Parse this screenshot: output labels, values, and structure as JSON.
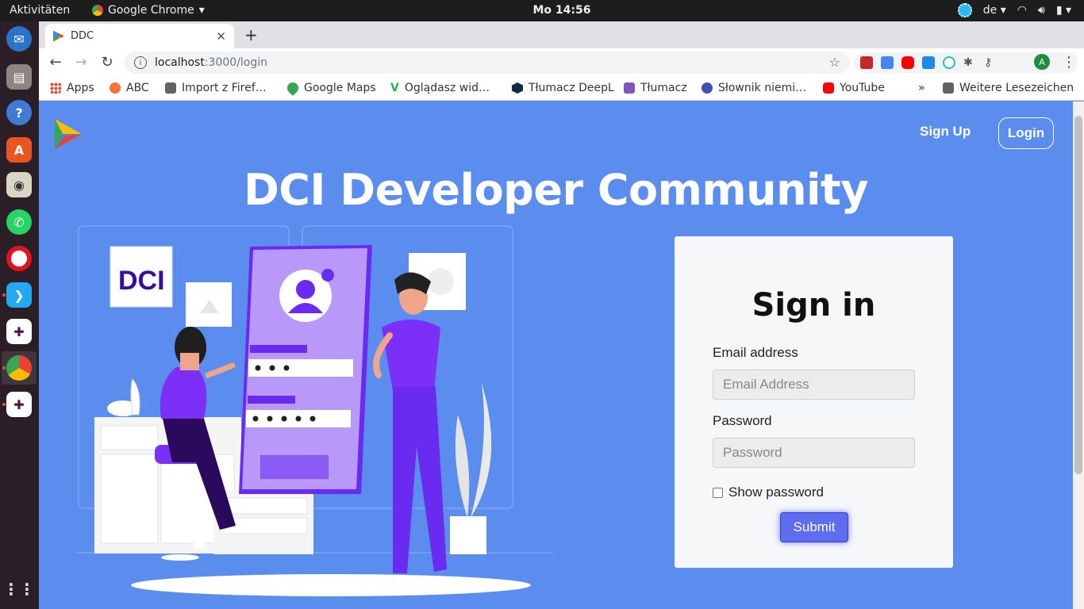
{
  "topbar": {
    "activities": "Aktivitäten",
    "app_name": "Google Chrome",
    "clock": "Mo 14:56",
    "lang": "de"
  },
  "browser": {
    "tab_title": "DDC",
    "url_host": "localhost",
    "url_path": ":3000/login",
    "profile_initial": "A",
    "bookmarks": [
      {
        "label": "Apps",
        "icon": "apps-grid-icon",
        "color": "#ea4335"
      },
      {
        "label": "ABC",
        "icon": "firefox-icon",
        "color": "#ff7139"
      },
      {
        "label": "Import z Firef…",
        "icon": "folder-icon",
        "color": "#5f6368"
      },
      {
        "label": "Google Maps",
        "icon": "maps-pin-icon",
        "color": "#34a853"
      },
      {
        "label": "Oglądasz wid…",
        "icon": "v-icon",
        "color": "#1db954"
      },
      {
        "label": "Tłumacz DeepL",
        "icon": "deepl-icon",
        "color": "#0f2b46"
      },
      {
        "label": "Tłumacz",
        "icon": "translate-icon",
        "color": "#7e57c2"
      },
      {
        "label": "Słownik niemi…",
        "icon": "speech-icon",
        "color": "#3f51b5"
      },
      {
        "label": "YouTube",
        "icon": "youtube-icon",
        "color": "#ff0000"
      }
    ],
    "more_bookmarks": "»",
    "other_bookmarks": "Weitere Lesezeichen"
  },
  "page": {
    "nav_signup": "Sign Up",
    "nav_login": "Login",
    "hero_title": "DCI Developer Community",
    "illustration_logo_text": "DCI",
    "form": {
      "title": "Sign in",
      "email_label": "Email address",
      "email_placeholder": "Email Address",
      "password_label": "Password",
      "password_placeholder": "Password",
      "show_password": "Show password",
      "submit": "Submit"
    }
  }
}
